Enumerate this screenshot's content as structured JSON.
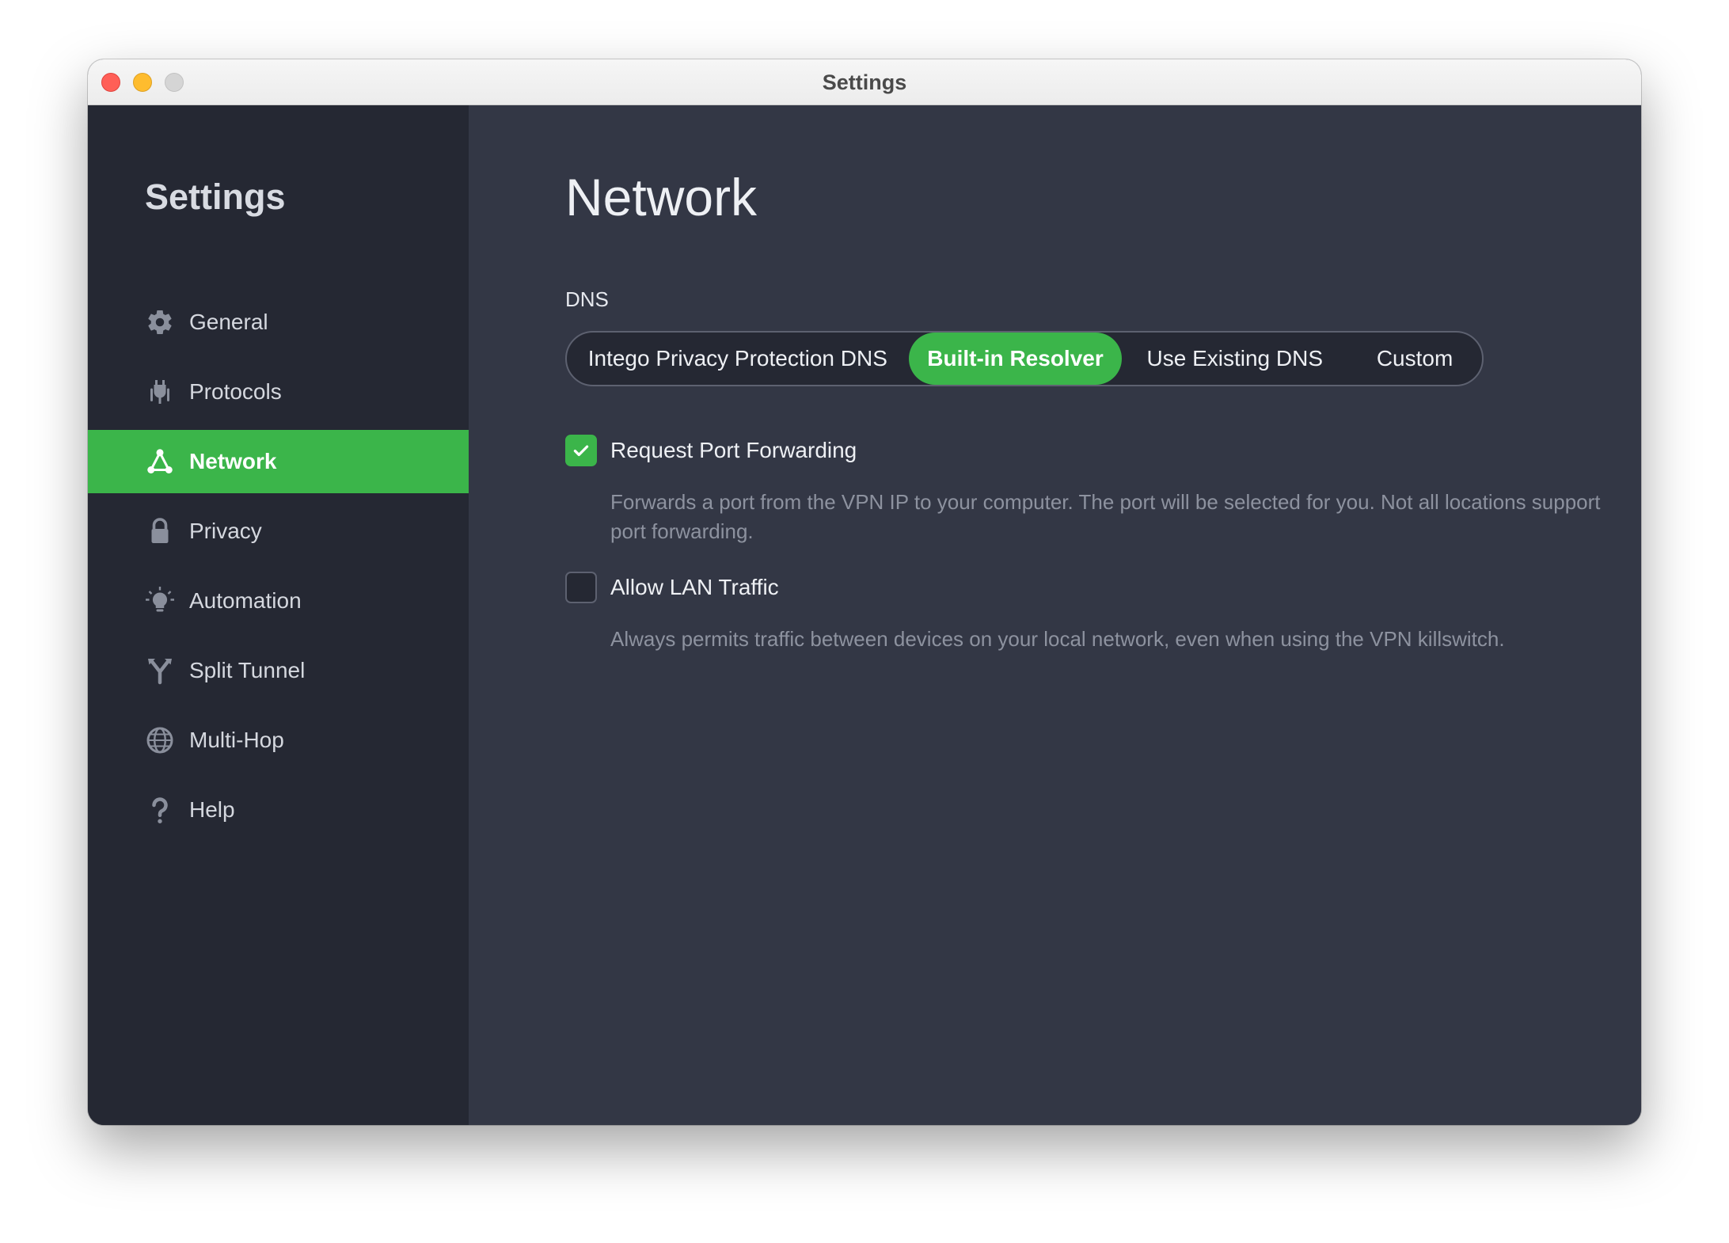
{
  "window": {
    "title": "Settings"
  },
  "sidebar": {
    "title": "Settings",
    "items": [
      {
        "label": "General",
        "icon": "gear-icon",
        "active": false
      },
      {
        "label": "Protocols",
        "icon": "plug-icon",
        "active": false
      },
      {
        "label": "Network",
        "icon": "network-icon",
        "active": true
      },
      {
        "label": "Privacy",
        "icon": "lock-icon",
        "active": false
      },
      {
        "label": "Automation",
        "icon": "lightbulb-icon",
        "active": false
      },
      {
        "label": "Split Tunnel",
        "icon": "split-arrow-icon",
        "active": false
      },
      {
        "label": "Multi-Hop",
        "icon": "globe-icon",
        "active": false
      },
      {
        "label": "Help",
        "icon": "question-icon",
        "active": false
      }
    ]
  },
  "main": {
    "title": "Network",
    "dns": {
      "label": "DNS",
      "options": [
        "Intego Privacy Protection DNS",
        "Built-in Resolver",
        "Use Existing DNS",
        "Custom"
      ],
      "selected": "Built-in Resolver"
    },
    "port_forwarding": {
      "label": "Request Port Forwarding",
      "checked": true,
      "description": "Forwards a port from the VPN IP to your computer. The port will be selected for you. Not all locations support port forwarding."
    },
    "lan_traffic": {
      "label": "Allow LAN Traffic",
      "checked": false,
      "description": "Always permits traffic between devices on your local network, even when using the VPN killswitch."
    }
  },
  "colors": {
    "accent": "#3bb54a",
    "sidebar_bg": "#252833",
    "main_bg": "#333745"
  }
}
